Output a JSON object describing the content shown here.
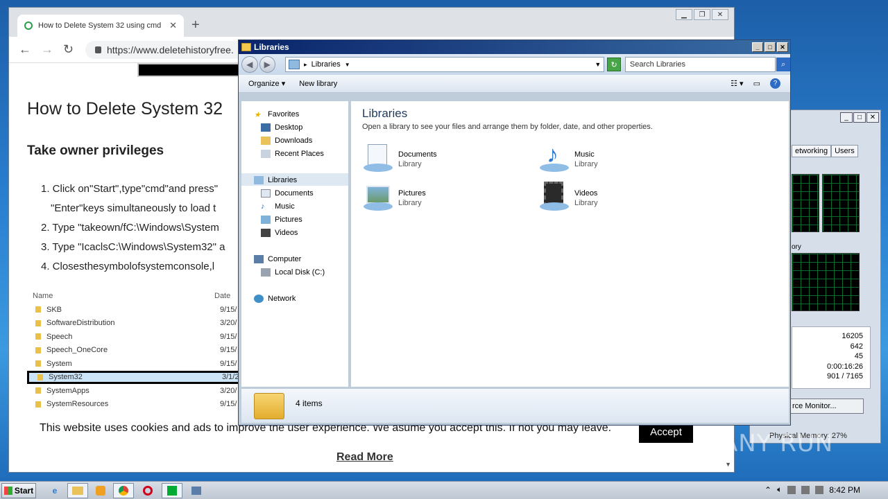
{
  "browser": {
    "tab_title": "How to Delete System 32 using cmd",
    "url": "https://www.deletehistoryfree.",
    "heading": "How to Delete System 32",
    "subheading": "Take owner privileges",
    "steps": [
      "1. Click on\"Start\",type\"cmd\"and press\"",
      "\"Enter\"keys simultaneously to load t",
      "2. Type \"takeown/fC:\\Windows\\System",
      "3. Type \"IcaclsC:\\Windows\\System32\" a",
      "4.  Closesthesymbolofsystemconsole,l"
    ],
    "screenshot_table": {
      "col_name": "Name",
      "col_date": "Date",
      "rows": [
        {
          "name": "SKB",
          "date": "9/15/"
        },
        {
          "name": "SoftwareDistribution",
          "date": "3/20/"
        },
        {
          "name": "Speech",
          "date": "9/15/"
        },
        {
          "name": "Speech_OneCore",
          "date": "9/15/"
        },
        {
          "name": "System",
          "date": "9/15/"
        },
        {
          "name": "System32",
          "date": "3/1/2"
        },
        {
          "name": "SystemApps",
          "date": "3/20/"
        },
        {
          "name": "SystemResources",
          "date": "9/15/"
        }
      ]
    },
    "cookie_message": "This website uses cookies and ads to improve the user experience. We asume you accept this. If not you may leave.",
    "accept_label": "Accept",
    "read_more_label": "Read More"
  },
  "explorer": {
    "title": "Libraries",
    "breadcrumb": "Libraries",
    "search_placeholder": "Search Libraries",
    "toolbar": {
      "organize": "Organize",
      "new_library": "New library"
    },
    "nav": {
      "favorites": "Favorites",
      "desktop": "Desktop",
      "downloads": "Downloads",
      "recent_places": "Recent Places",
      "libraries": "Libraries",
      "documents": "Documents",
      "music": "Music",
      "pictures": "Pictures",
      "videos": "Videos",
      "computer": "Computer",
      "local_disk": "Local Disk (C:)",
      "network": "Network"
    },
    "content_title": "Libraries",
    "content_subtitle": "Open a library to see your files and arrange them by folder, date, and other properties.",
    "libraries": [
      {
        "name": "Documents",
        "kind": "Library",
        "icon": "documents-library-icon"
      },
      {
        "name": "Music",
        "kind": "Library",
        "icon": "music-library-icon"
      },
      {
        "name": "Pictures",
        "kind": "Library",
        "icon": "pictures-library-icon"
      },
      {
        "name": "Videos",
        "kind": "Library",
        "icon": "videos-library-icon"
      }
    ],
    "status": "4 items"
  },
  "taskmgr": {
    "tabs": [
      "etworking",
      "Users"
    ],
    "memory_label": "ory",
    "stats": [
      "16205",
      "642",
      "45",
      "0:00:16:26",
      "901 / 7165"
    ],
    "resource_monitor": "rce Monitor...",
    "physical_memory": "Physical Memory: 27%"
  },
  "taskbar": {
    "start": "Start",
    "clock": "8:42 PM"
  },
  "watermark": "ANY RUN",
  "colors": {
    "title_bar": "#0a246a",
    "accent": "#2d6cc2",
    "selection": "#dde8f3"
  }
}
